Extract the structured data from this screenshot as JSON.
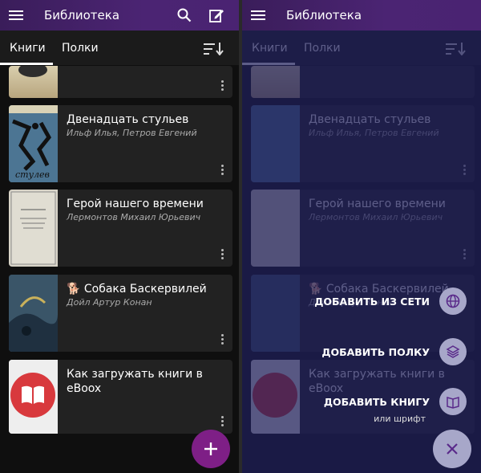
{
  "app": {
    "title": "Библиотека"
  },
  "tabs": [
    {
      "label": "Книги"
    },
    {
      "label": "Полки"
    }
  ],
  "books": [
    {
      "title": "",
      "author": ""
    },
    {
      "title": "Двенадцать стульев",
      "author": "Ильф Илья, Петров Евгений"
    },
    {
      "title": "Герой нашего времени",
      "author": "Лермонтов Михаил Юрьевич"
    },
    {
      "title": "🐕 Собака Баскервилей",
      "author": "Дойл Артур Конан"
    },
    {
      "title": "Как загружать книги в eBoox",
      "author": ""
    }
  ],
  "fab_menu": {
    "add_from_web": "ДОБАВИТЬ ИЗ СЕТИ",
    "add_shelf": "ДОБАВИТЬ ПОЛКУ",
    "add_book": "ДОБАВИТЬ КНИГУ",
    "add_book_sub": "или шрифт"
  },
  "colors": {
    "accent": "#7e1f86",
    "topbar": "#4b2473",
    "overlay": "#1e1e5a"
  }
}
